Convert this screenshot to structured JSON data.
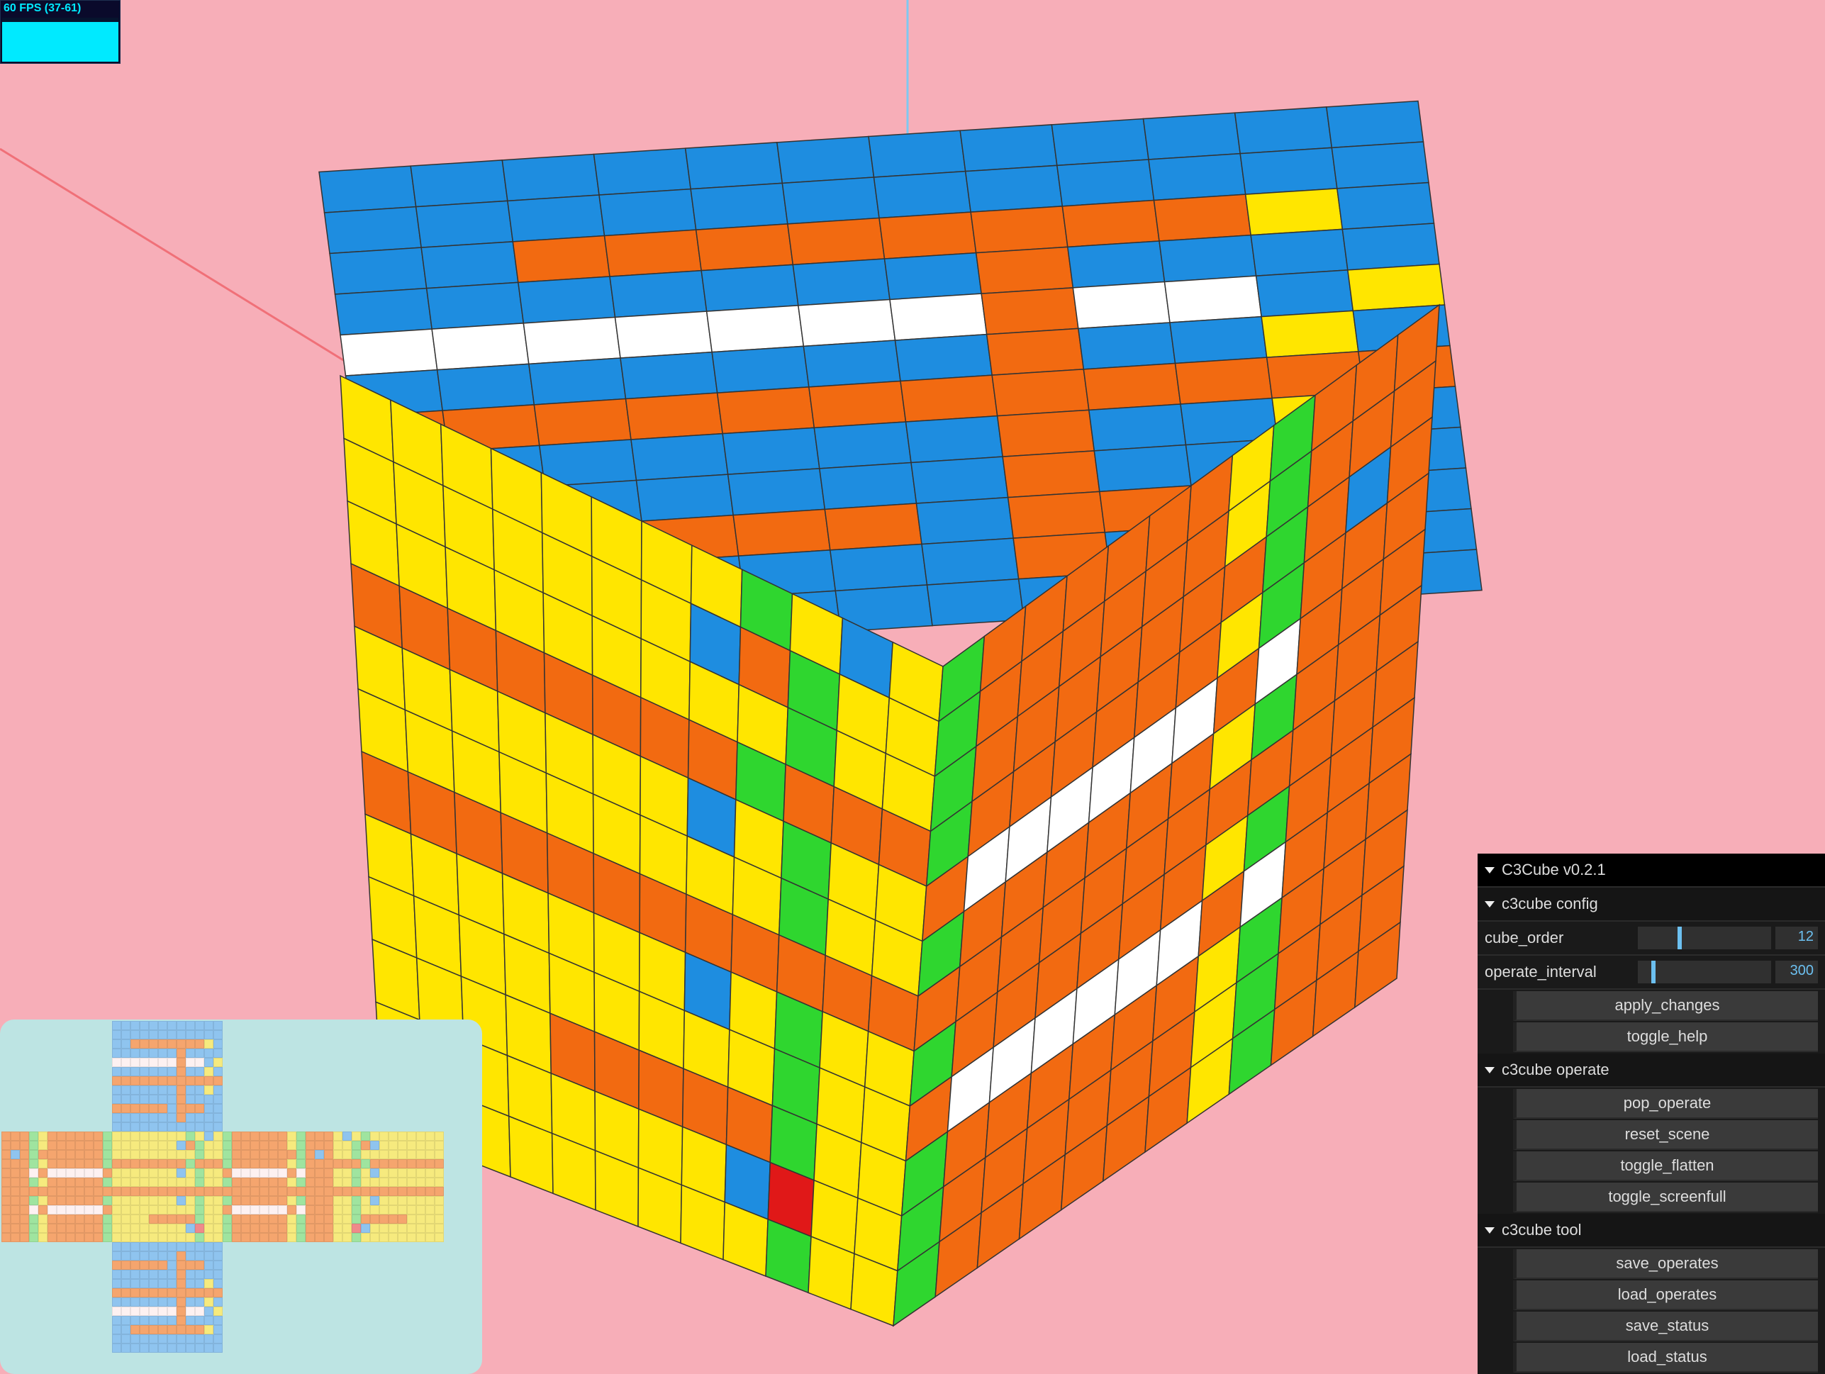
{
  "fps": {
    "label": "60 FPS (37-61)"
  },
  "gui": {
    "title": "C3Cube v0.2.1",
    "sections": [
      {
        "name": "c3cube config",
        "props": [
          {
            "label": "cube_order",
            "value": "12",
            "slider_pct": 30
          },
          {
            "label": "operate_interval",
            "value": "300",
            "slider_pct": 10
          }
        ],
        "buttons": [
          "apply_changes",
          "toggle_help"
        ]
      },
      {
        "name": "c3cube operate",
        "buttons": [
          "pop_operate",
          "reset_scene",
          "toggle_flatten",
          "toggle_screenfull"
        ]
      },
      {
        "name": "c3cube tool",
        "buttons": [
          "save_operates",
          "load_operates",
          "save_status",
          "load_status"
        ]
      }
    ]
  },
  "cube": {
    "order": 12,
    "axes": {
      "x_color": "#f07078",
      "y_color": "#7fc8f0",
      "z_color": "#f0c030"
    },
    "colors": {
      "B": "#1e8de0",
      "O": "#f26a11",
      "Y": "#ffe600",
      "W": "#ffffff",
      "G": "#2fd62f",
      "R": "#e01818"
    },
    "top_face": [
      "BBBBBBBBBBBB",
      "BBBBBBBBBBBB",
      "BBOOOOOOOOYB",
      "BBBBBBBOBBBB",
      "WWWWWWWOWWBY",
      "BBBBBBBOBBYB",
      "OOOOOOOOOOOO",
      "BBBBBBBOBBYB",
      "BBBBBBBOBBBB",
      "OOOOOOBOOOBB",
      "BBBBBBBOBBBB",
      "BBBBBBBBBBBB"
    ],
    "front_face": [
      "YYYYYYYYGYBY",
      "YYYYYYYBOGYY",
      "YYYYYYYYYGYY",
      "OOOOOOOOGOOO",
      "YYYYYYYBYGYY",
      "YYYYYYYYYGYY",
      "OOOOOOOOOOOO",
      "YYYYYYYBYGYY",
      "YYYYYYYYYGYY",
      "YYYYOOOOOGYY",
      "YYYYYYYYBRYY",
      "YYYYYYYYYGYY"
    ],
    "right_face": [
      "GOOOOOOYGOOO",
      "GOOOOOOYGOOO",
      "GOOOOOOOGOBO",
      "GOOOOOOYGOOO",
      "OWWWWWWOWOOO",
      "GOOOOOOYGOOO",
      "OOOOOOOOOOOO",
      "GOOOOOOYGOOO",
      "OWWWWWWOWOOO",
      "GOOOOOOYGOOO",
      "GOOOOOOYGOOO",
      "GOOOOOOYGOOO"
    ]
  },
  "minimap": {
    "note": "cross layout of all 6 faces, 12x12 each — same face data as cube.*_face plus hidden faces",
    "faces_layout": [
      "top",
      "left front right back",
      "bottom"
    ]
  }
}
